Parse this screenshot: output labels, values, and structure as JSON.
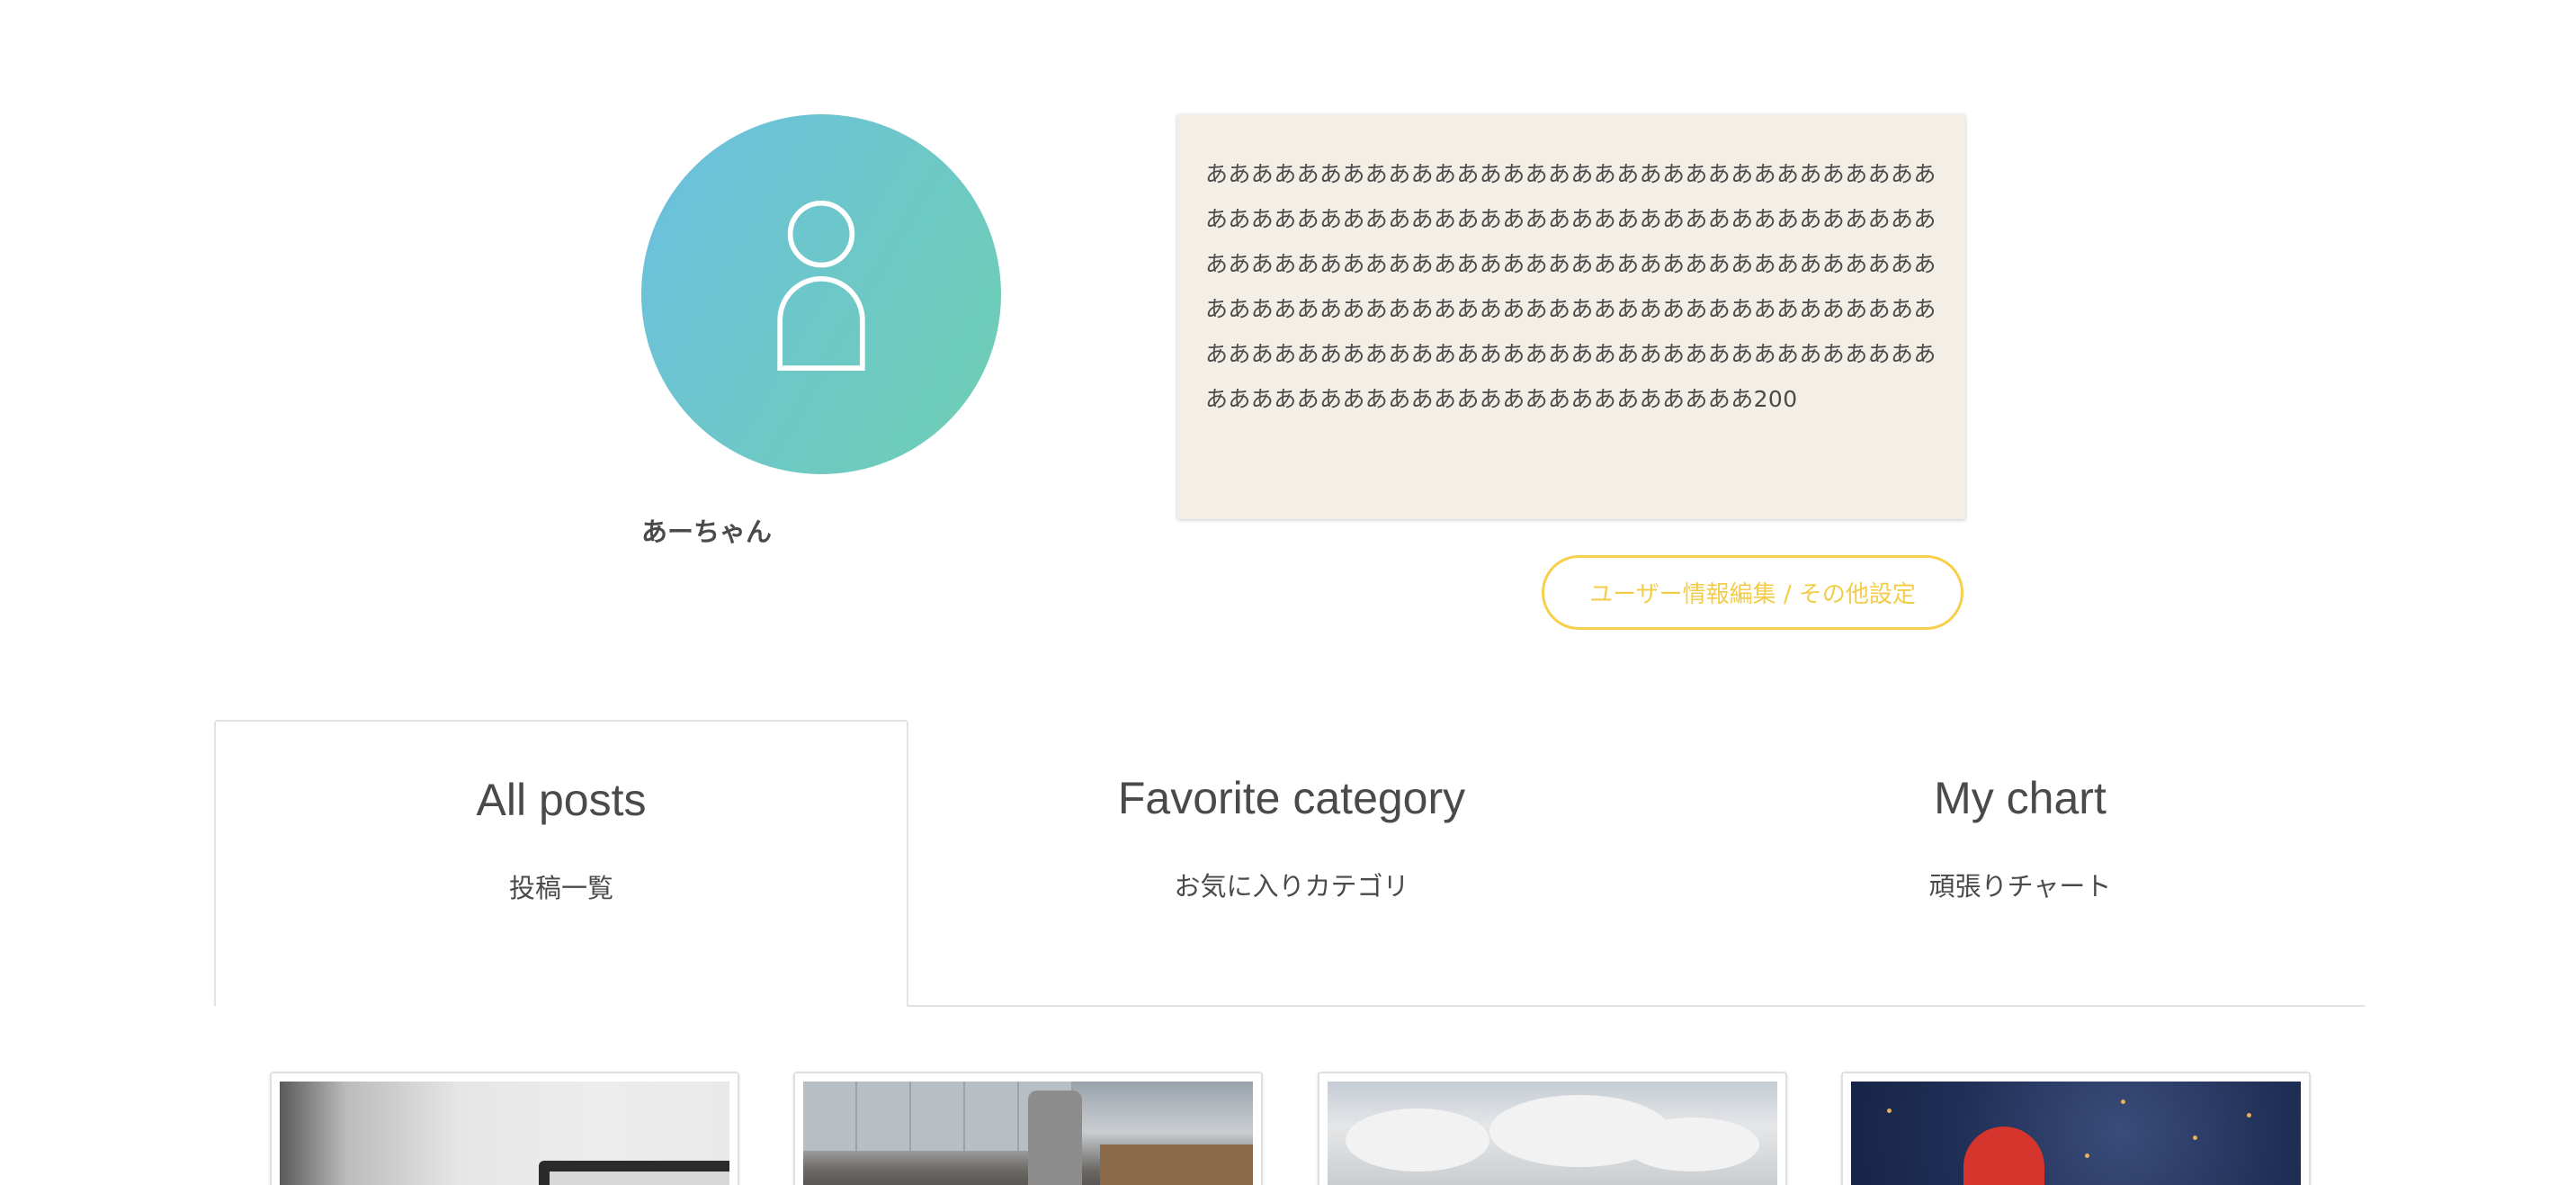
{
  "profile": {
    "username": "あーちゃん",
    "bio": "ああああああああああああああああああああああああああああああああああああああああああああああああああああああああああああああああああああああああああああああああああああああああああああああああああああああああああああああああああああああああああああああああああああああああああああああああああああああああああああああああああああああああああああああああああああああああ200",
    "avatar_icon": "user-icon",
    "edit_button_label": "ユーザー情報編集 / その他設定",
    "colors": {
      "avatar_gradient_start": "#6bbfe0",
      "avatar_gradient_end": "#6fcfb2",
      "bio_background": "#f3efe7",
      "edit_button_accent": "#f6d04d"
    }
  },
  "tabs": [
    {
      "title": "All posts",
      "subtitle": "投稿一覧",
      "active": true
    },
    {
      "title": "Favorite category",
      "subtitle": "お気に入りカテゴリ",
      "active": false
    },
    {
      "title": "My chart",
      "subtitle": "頑張りチャート",
      "active": false
    }
  ],
  "posts": [
    {
      "thumbnail": "laptop-on-desk-photo"
    },
    {
      "thumbnail": "kitchen-stove-photo"
    },
    {
      "thumbnail": "sky-clouds-photo"
    },
    {
      "thumbnail": "red-heart-balloon-photo"
    }
  ]
}
